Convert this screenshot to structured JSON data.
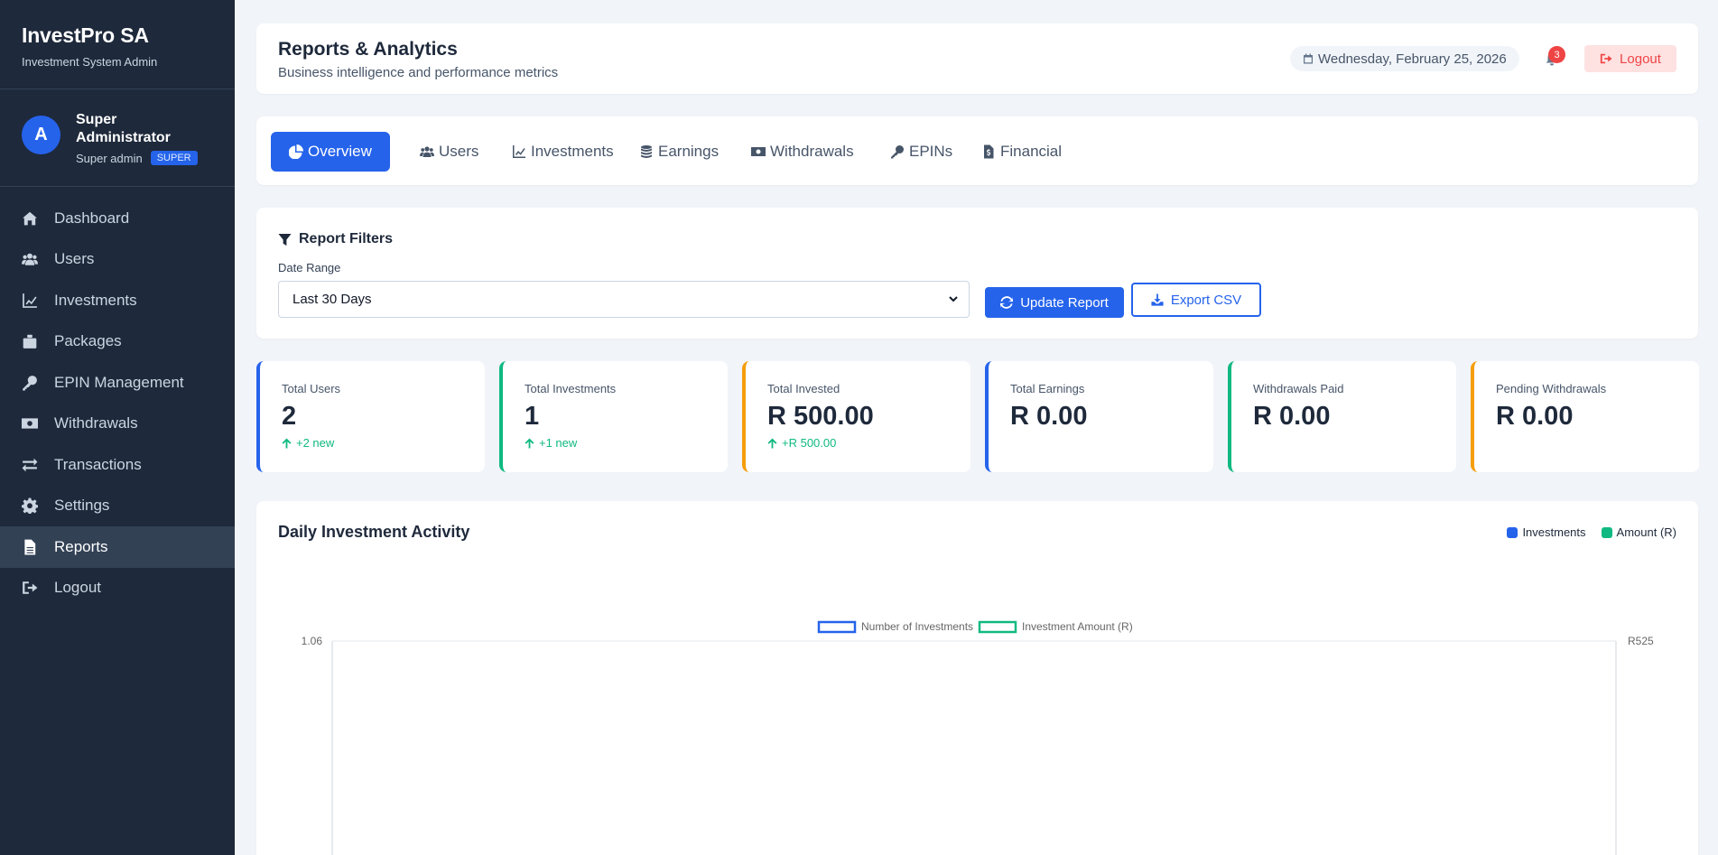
{
  "brand": {
    "title": "InvestPro SA",
    "subtitle": "Investment System Admin"
  },
  "profile": {
    "initial": "A",
    "name": "Super Administrator",
    "role": "Super admin",
    "badge": "SUPER"
  },
  "sidebar": {
    "items": [
      {
        "label": "Dashboard",
        "icon": "home-icon"
      },
      {
        "label": "Users",
        "icon": "users-icon"
      },
      {
        "label": "Investments",
        "icon": "chart-line-icon"
      },
      {
        "label": "Packages",
        "icon": "box-icon"
      },
      {
        "label": "EPIN Management",
        "icon": "key-icon"
      },
      {
        "label": "Withdrawals",
        "icon": "money-icon"
      },
      {
        "label": "Transactions",
        "icon": "exchange-icon"
      },
      {
        "label": "Settings",
        "icon": "gear-icon"
      },
      {
        "label": "Reports",
        "icon": "file-icon"
      },
      {
        "label": "Logout",
        "icon": "logout-icon"
      }
    ],
    "active": "Reports"
  },
  "header": {
    "title": "Reports & Analytics",
    "subtitle": "Business intelligence and performance metrics",
    "date": "Wednesday, February 25, 2026",
    "notifications": "3",
    "logout": "Logout"
  },
  "tabs": [
    {
      "label": "Overview",
      "icon": "pie-icon"
    },
    {
      "label": "Users",
      "icon": "users-icon"
    },
    {
      "label": "Investments",
      "icon": "chart-line-icon"
    },
    {
      "label": "Earnings",
      "icon": "coins-icon"
    },
    {
      "label": "Withdrawals",
      "icon": "money-icon"
    },
    {
      "label": "EPINs",
      "icon": "key-icon"
    },
    {
      "label": "Financial",
      "icon": "invoice-icon"
    }
  ],
  "filters": {
    "title": "Report Filters",
    "date_label": "Date Range",
    "date_value": "Last 30 Days",
    "update": "Update Report",
    "export": "Export CSV"
  },
  "stats": [
    {
      "label": "Total Users",
      "value": "2",
      "change": "+2 new",
      "color": "#2563eb"
    },
    {
      "label": "Total Investments",
      "value": "1",
      "change": "+1 new",
      "color": "#10b981"
    },
    {
      "label": "Total Invested",
      "value": "R 500.00",
      "change": "+R 500.00",
      "color": "#f59e0b"
    },
    {
      "label": "Total Earnings",
      "value": "R 0.00",
      "change": "",
      "color": "#2563eb"
    },
    {
      "label": "Withdrawals Paid",
      "value": "R 0.00",
      "change": "",
      "color": "#10b981"
    },
    {
      "label": "Pending Withdrawals",
      "value": "R 0.00",
      "change": "",
      "color": "#f59e0b"
    }
  ],
  "chart": {
    "title": "Daily Investment Activity",
    "legend_top": [
      {
        "label": "Investments",
        "color": "#2563eb"
      },
      {
        "label": "Amount (R)",
        "color": "#10b981"
      }
    ]
  },
  "chart_data": {
    "type": "line",
    "series": [
      {
        "name": "Number of Investments",
        "color": "#2563eb",
        "values": []
      },
      {
        "name": "Investment Amount (R)",
        "color": "#10b981",
        "values": []
      }
    ],
    "y_left_top_tick": "1.06",
    "y_right_top_tick": "R525",
    "grid": true
  }
}
